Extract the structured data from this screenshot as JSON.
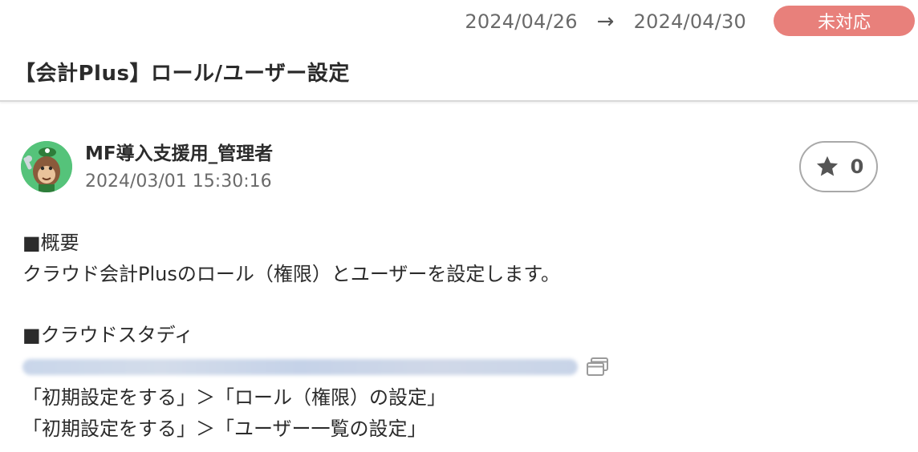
{
  "header": {
    "date_start": "2024/04/26",
    "date_arrow": "→",
    "date_end": "2024/04/30",
    "status": "未対応",
    "title": "【会計Plus】ロール/ユーザー設定"
  },
  "post": {
    "author": "MF導入支援用_管理者",
    "timestamp": "2024/03/01 15:30:16",
    "star_count": "0"
  },
  "content": {
    "overview_heading": "■概要",
    "overview_text": "クラウド会計Plusのロール（権限）とユーザーを設定します。",
    "study_heading": "■クラウドスタディ",
    "step_1": "「初期設定をする」＞「ロール（権限）の設定」",
    "step_2": "「初期設定をする」＞「ユーザー一覧の設定」"
  },
  "colors": {
    "status_badge": "#e8807b",
    "avatar_bg": "#55c37a"
  }
}
